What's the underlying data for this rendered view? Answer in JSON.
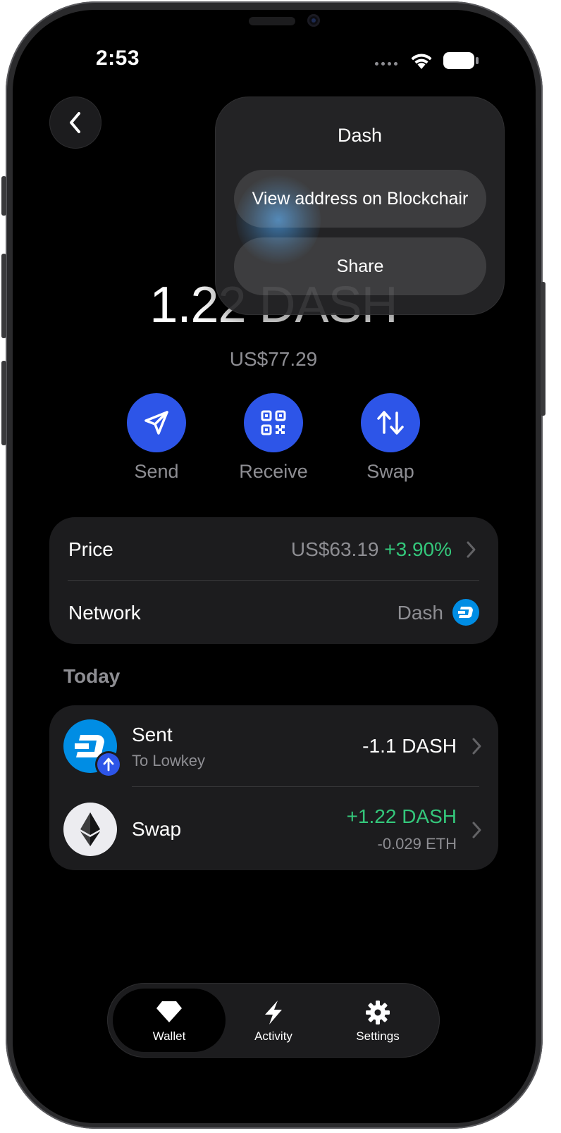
{
  "status_bar": {
    "time": "2:53"
  },
  "wallet": {
    "balance": "1.22 DASH",
    "fiat_value": "US$77.29"
  },
  "actions": [
    {
      "label": "Send",
      "icon": "send-icon"
    },
    {
      "label": "Receive",
      "icon": "qr-code-icon"
    },
    {
      "label": "Swap",
      "icon": "swap-arrows-icon"
    }
  ],
  "info": {
    "price_label": "Price",
    "price_value": "US$63.19",
    "price_change": "+3.90%",
    "network_label": "Network",
    "network_value": "Dash"
  },
  "section_title": "Today",
  "transactions": [
    {
      "title": "Sent",
      "subtitle": "To Lowkey",
      "amount": "-1.1 DASH",
      "icon": "dash-coin-icon"
    },
    {
      "title": "Swap",
      "amount": "+1.22 DASH",
      "secondary": "-0.029 ETH",
      "icon": "ethereum-icon"
    }
  ],
  "tabs": [
    {
      "label": "Wallet",
      "icon": "diamond-icon",
      "active": true
    },
    {
      "label": "Activity",
      "icon": "lightning-icon",
      "active": false
    },
    {
      "label": "Settings",
      "icon": "gear-icon",
      "active": false
    }
  ],
  "context_menu": {
    "title": "Dash",
    "items": [
      "View address on Blockchair",
      "Share"
    ]
  },
  "colors": {
    "accent": "#2d55e8",
    "positive": "#34c77b",
    "dash_blue": "#008de4"
  }
}
